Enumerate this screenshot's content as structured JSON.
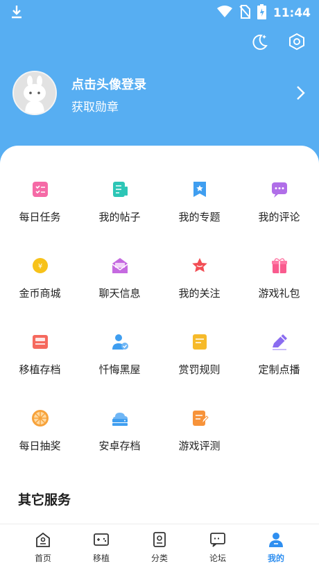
{
  "status_bar": {
    "time": "11:44"
  },
  "profile": {
    "title": "点击头像登录",
    "subtitle": "获取勋章"
  },
  "menu": [
    {
      "label": "每日任务",
      "icon": "task-list-icon"
    },
    {
      "label": "我的帖子",
      "icon": "posts-icon"
    },
    {
      "label": "我的专题",
      "icon": "topic-bookmark-icon"
    },
    {
      "label": "我的评论",
      "icon": "comment-icon"
    },
    {
      "label": "金币商城",
      "icon": "coin-icon"
    },
    {
      "label": "聊天信息",
      "icon": "chat-envelope-icon"
    },
    {
      "label": "我的关注",
      "icon": "star-icon"
    },
    {
      "label": "游戏礼包",
      "icon": "gift-icon"
    },
    {
      "label": "移植存档",
      "icon": "save-card-icon"
    },
    {
      "label": "忏悔黑屋",
      "icon": "user-shield-icon"
    },
    {
      "label": "赏罚规则",
      "icon": "rules-icon"
    },
    {
      "label": "定制点播",
      "icon": "pencil-icon"
    },
    {
      "label": "每日抽奖",
      "icon": "lottery-wheel-icon"
    },
    {
      "label": "安卓存档",
      "icon": "cloud-drive-icon"
    },
    {
      "label": "游戏评测",
      "icon": "review-icon"
    }
  ],
  "section": {
    "title": "其它服务"
  },
  "tabs": [
    {
      "label": "首页",
      "icon": "home-icon"
    },
    {
      "label": "移植",
      "icon": "gamepad-icon"
    },
    {
      "label": "分类",
      "icon": "category-icon"
    },
    {
      "label": "论坛",
      "icon": "forum-icon"
    },
    {
      "label": "我的",
      "icon": "profile-icon",
      "active": true
    }
  ],
  "colors": {
    "header": "#57aef2",
    "accent": "#2f8ff0"
  }
}
